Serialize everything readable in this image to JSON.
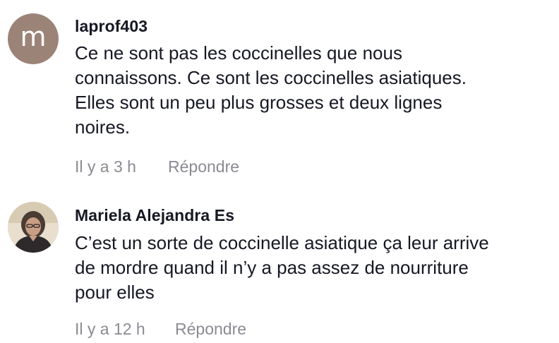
{
  "comments": [
    {
      "avatar_letter": "m",
      "avatar_color": "#9c8378",
      "username": "laprof403",
      "text_lines": [
        "Ce ne sont pas les coccinelles que nous",
        "connaissons. Ce sont les coccinelles asiatiques.",
        "Elles sont un peu plus grosses et deux lignes",
        "noires."
      ],
      "time": "Il y a 3 h",
      "reply_label": "Répondre"
    },
    {
      "avatar_icon": "user-photo-avatar",
      "username": "Mariela Alejandra Es",
      "text_lines": [
        "C’est un sorte de coccinelle asiatique ça leur arrive",
        "de mordre quand il n’y a pas assez de nourriture",
        "pour elles"
      ],
      "time": "Il y a 12 h",
      "reply_label": "Répondre"
    }
  ],
  "colors": {
    "text": "#161823",
    "meta": "#8a8b91",
    "background": "#ffffff"
  }
}
